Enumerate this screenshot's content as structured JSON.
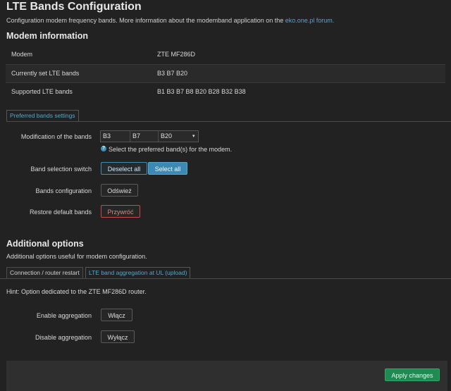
{
  "page": {
    "title": "LTE Bands Configuration",
    "description_prefix": "Configuration modem frequency bands. More information about the modemband application on the ",
    "description_link": "eko.one.pl forum."
  },
  "modem_info": {
    "title": "Modem information",
    "rows": [
      {
        "label": "Modem",
        "value": "ZTE MF286D"
      },
      {
        "label": "Currently set LTE bands",
        "value": "B3 B7 B20"
      },
      {
        "label": "Supported LTE bands",
        "value": "B1 B3 B7 B8 B20 B28 B32 B38"
      }
    ]
  },
  "preferred": {
    "tab_label": "Preferred bands settings",
    "modification_label": "Modification of the bands",
    "selected_bands": [
      "B3",
      "B7",
      "B20"
    ],
    "help_text": "Select the preferred band(s) for the modem.",
    "switch_label": "Band selection switch",
    "deselect_all": "Deselect all",
    "select_all": "Select all",
    "config_label": "Bands configuration",
    "refresh_button": "Odśwież",
    "restore_label": "Restore default bands",
    "restore_button": "Przywróć"
  },
  "additional": {
    "title": "Additional options",
    "description": "Additional options useful for modem configuration.",
    "tabs": [
      {
        "label": "Connection / router restart",
        "active": false
      },
      {
        "label": "LTE band aggregation at UL (upload)",
        "active": true
      }
    ],
    "hint": "Hint: Option dedicated to the ZTE MF286D router.",
    "enable_label": "Enable aggregation",
    "enable_button": "Włącz",
    "disable_label": "Disable aggregation",
    "disable_button": "Wyłącz"
  },
  "footer": {
    "apply_button": "Apply changes"
  },
  "colors": {
    "background": "#222222",
    "accent": "#3c8ab4",
    "link": "#4fa8cf",
    "apply": "#1f8a52",
    "danger": "#c84a4a"
  }
}
